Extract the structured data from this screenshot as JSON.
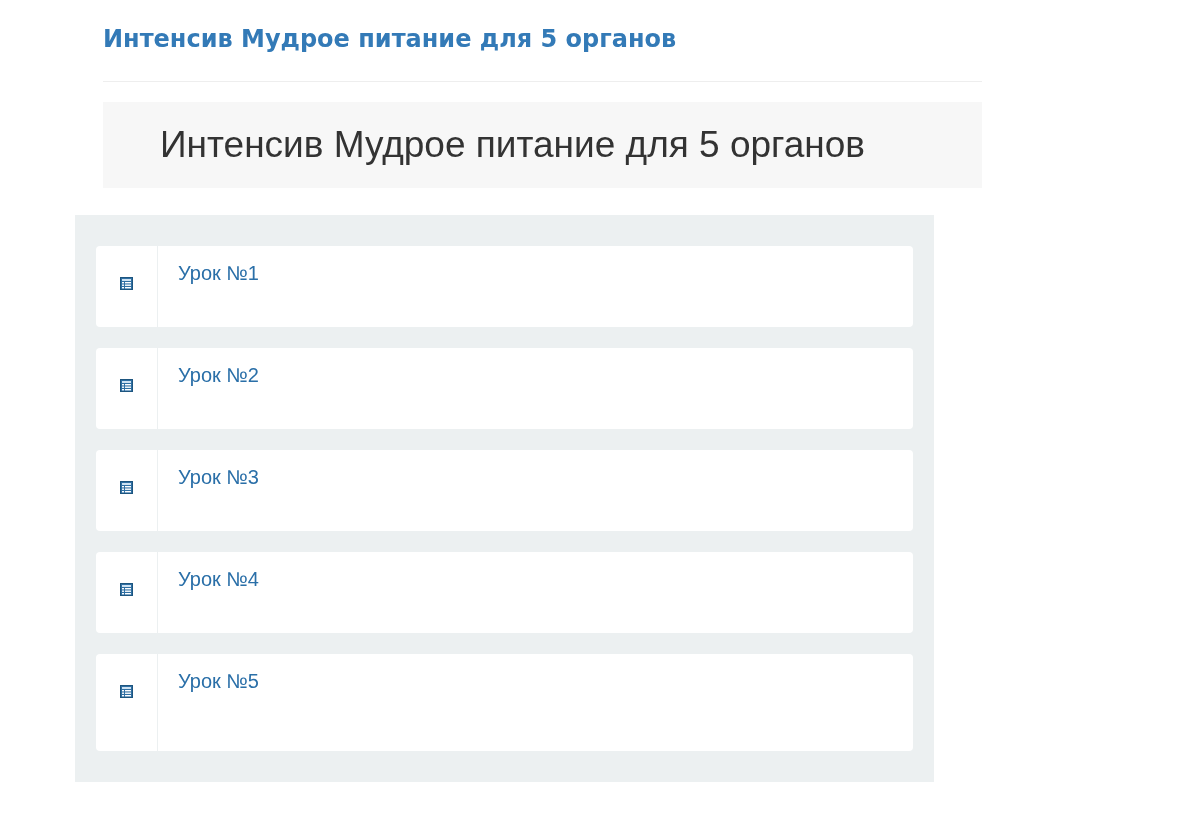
{
  "page_title": "Интенсив Мудрое питание для 5 органов",
  "banner": {
    "title": "Интенсив Мудрое питание для 5 органов"
  },
  "lessons": [
    {
      "title": "Урок №1"
    },
    {
      "title": "Урок №2"
    },
    {
      "title": "Урок №3"
    },
    {
      "title": "Урок №4"
    },
    {
      "title": "Урок №5"
    }
  ]
}
